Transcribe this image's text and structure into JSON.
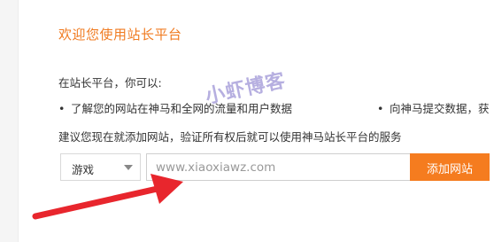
{
  "title": "欢迎您使用站长平台",
  "intro": "在站长平台，你可以:",
  "bullets": [
    "了解您的网站在神马和全网的流量和用户数据",
    "向神马提交数据，获"
  ],
  "advice": "建议您现在就添加网站，验证所有权后就可以使用神马站长平台的服务",
  "form": {
    "category_selected": "游戏",
    "url_placeholder": "www.xiaoxiawz.com",
    "add_button": "添加网站",
    "edge_text": "⁝"
  },
  "watermark": "小虾博客",
  "colors": {
    "accent": "#f57c1f",
    "title": "#f07b21",
    "arrow": "#e8262d",
    "watermark": "#7b6ec7"
  },
  "icons": {
    "select_caret": "chevron-down-icon",
    "annotation": "red-arrow-icon"
  }
}
